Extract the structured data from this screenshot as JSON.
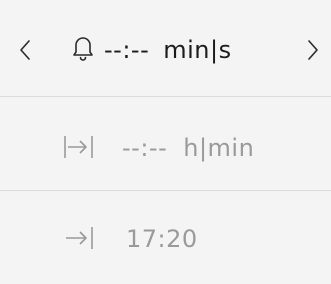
{
  "timer": {
    "value": "--:--",
    "unit": "min|s",
    "prev_icon": "chevron-left-icon",
    "next_icon": "chevron-right-icon",
    "bell_icon": "bell-icon"
  },
  "duration": {
    "value": "--:--",
    "unit": "h|min",
    "icon": "duration-span-icon"
  },
  "end_time": {
    "value": "17:20",
    "icon": "end-time-icon"
  },
  "colors": {
    "background": "#f4f4f4",
    "text_primary": "#1c1c1c",
    "text_secondary": "#9a9a9a",
    "divider": "#dcdcdc"
  }
}
